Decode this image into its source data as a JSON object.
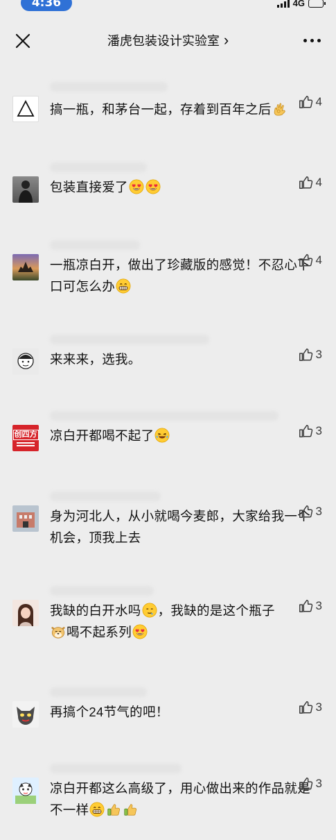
{
  "status": {
    "time": "4:36",
    "network": "4G"
  },
  "nav": {
    "title": "潘虎包装设计实验室",
    "chevron": "›"
  },
  "comments": [
    {
      "avatar": "triangle-avatar",
      "likes": "4",
      "text": "搞一瓶，和茅台一起，存着到百年之后",
      "emojis": [
        "ok-hand"
      ]
    },
    {
      "avatar": "person-dark-avatar",
      "likes": "4",
      "text": "包装直接爱了",
      "emojis": [
        "heart-eyes",
        "heart-eyes"
      ]
    },
    {
      "avatar": "landscape-avatar",
      "likes": "4",
      "text": "一瓶凉白开，做出了珍藏版的感觉！不忍心下口可怎么办",
      "emojis": [
        "grin"
      ]
    },
    {
      "avatar": "cartoon-face-avatar",
      "likes": "3",
      "text": "来来来，选我。",
      "emojis": []
    },
    {
      "avatar": "brand-logo-avatar",
      "likes": "3",
      "text": "凉白开都喝不起了",
      "emojis": [
        "laugh-cry"
      ]
    },
    {
      "avatar": "building-avatar",
      "likes": "3",
      "text": "身为河北人，从小就喝今麦郎，大家给我一个机会，顶我上去",
      "emojis": []
    },
    {
      "avatar": "girl-avatar",
      "likes": "3",
      "text_parts": [
        "我缺的白开水吗",
        "，我缺的是这个瓶子",
        "喝不起系列"
      ],
      "emojis": [
        "drool",
        "doge",
        "heart-eyes"
      ]
    },
    {
      "avatar": "cat-avatar",
      "likes": "3",
      "text": "再搞个24节气的吧！",
      "emojis": []
    },
    {
      "avatar": "anime-avatar",
      "likes": "3",
      "text": "凉白开都这么高级了，用心做出来的作品就是不一样",
      "emojis": [
        "grin",
        "thumbs-up",
        "thumbs-up"
      ]
    }
  ],
  "brand_logo_text": "创四方",
  "colors": {
    "background": "#ededed",
    "time_pill": "#2f71d6",
    "text": "#111111",
    "like": "#3a3a3a"
  }
}
